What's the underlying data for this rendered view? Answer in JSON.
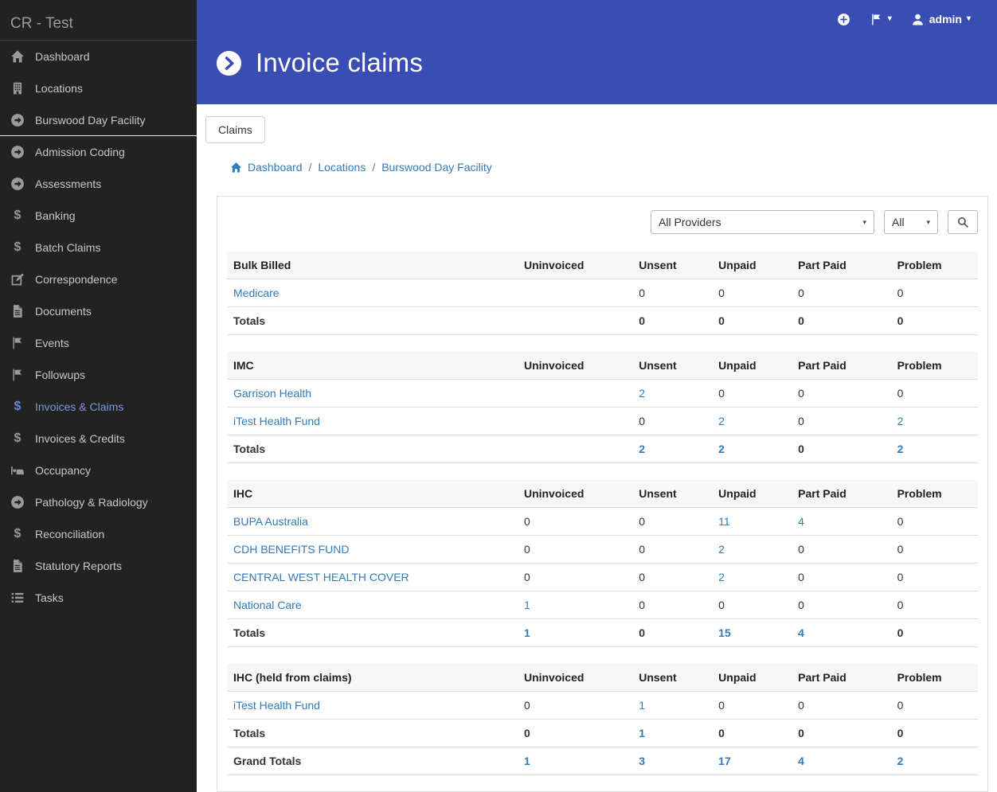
{
  "app": {
    "title": "CR - Test"
  },
  "colors": {
    "banner": "#3a4db3",
    "link": "#337ab7",
    "sidebar_bg": "#222222"
  },
  "sidebar": {
    "items": [
      {
        "label": "Dashboard",
        "icon": "home"
      },
      {
        "label": "Locations",
        "icon": "building"
      },
      {
        "label": "Burswood Day Facility",
        "icon": "arrow-circle",
        "divider_below": true
      },
      {
        "label": "Admission Coding",
        "icon": "arrow-circle"
      },
      {
        "label": "Assessments",
        "icon": "arrow-circle"
      },
      {
        "label": "Banking",
        "icon": "dollar"
      },
      {
        "label": "Batch Claims",
        "icon": "dollar"
      },
      {
        "label": "Correspondence",
        "icon": "pencil"
      },
      {
        "label": "Documents",
        "icon": "file"
      },
      {
        "label": "Events",
        "icon": "flag"
      },
      {
        "label": "Followups",
        "icon": "flag"
      },
      {
        "label": "Invoices & Claims",
        "icon": "dollar",
        "active": true
      },
      {
        "label": "Invoices & Credits",
        "icon": "dollar"
      },
      {
        "label": "Occupancy",
        "icon": "bed"
      },
      {
        "label": "Pathology & Radiology",
        "icon": "arrow-circle"
      },
      {
        "label": "Reconciliation",
        "icon": "dollar"
      },
      {
        "label": "Statutory Reports",
        "icon": "file"
      },
      {
        "label": "Tasks",
        "icon": "list"
      }
    ]
  },
  "header": {
    "title": "Invoice claims",
    "user": "admin"
  },
  "tabs": {
    "claims": "Claims"
  },
  "breadcrumb": [
    "Dashboard",
    "Locations",
    "Burswood Day Facility"
  ],
  "filters": {
    "provider": "All Providers",
    "type": "All"
  },
  "claims": {
    "columns": [
      "Uninvoiced",
      "Unsent",
      "Unpaid",
      "Part Paid",
      "Problem"
    ],
    "totals_label": "Totals",
    "tables": [
      {
        "group": "Bulk Billed",
        "rows": [
          {
            "name": "Medicare",
            "values": [
              "",
              "0",
              "0",
              "0",
              "0"
            ],
            "links": [
              false,
              false,
              false,
              false,
              false
            ]
          }
        ],
        "totals": [
          "",
          "0",
          "0",
          "0",
          "0"
        ],
        "totals_links": [
          false,
          false,
          false,
          false,
          false
        ]
      },
      {
        "group": "IMC",
        "rows": [
          {
            "name": "Garrison Health",
            "values": [
              "",
              "2",
              "0",
              "0",
              "0"
            ],
            "links": [
              false,
              true,
              false,
              false,
              false
            ]
          },
          {
            "name": "iTest Health Fund",
            "values": [
              "",
              "0",
              "2",
              "0",
              "2"
            ],
            "links": [
              false,
              false,
              true,
              false,
              true
            ]
          }
        ],
        "totals": [
          "",
          "2",
          "2",
          "0",
          "2"
        ],
        "totals_links": [
          false,
          true,
          true,
          false,
          true
        ]
      },
      {
        "group": "IHC",
        "rows": [
          {
            "name": "BUPA Australia",
            "values": [
              "0",
              "0",
              "11",
              "4",
              "0"
            ],
            "links": [
              false,
              false,
              true,
              true,
              false
            ]
          },
          {
            "name": "CDH BENEFITS FUND",
            "values": [
              "0",
              "0",
              "2",
              "0",
              "0"
            ],
            "links": [
              false,
              false,
              true,
              false,
              false
            ]
          },
          {
            "name": "CENTRAL WEST HEALTH COVER",
            "values": [
              "0",
              "0",
              "2",
              "0",
              "0"
            ],
            "links": [
              false,
              false,
              true,
              false,
              false
            ]
          },
          {
            "name": "National Care",
            "values": [
              "1",
              "0",
              "0",
              "0",
              "0"
            ],
            "links": [
              true,
              false,
              false,
              false,
              false
            ]
          }
        ],
        "totals": [
          "1",
          "0",
          "15",
          "4",
          "0"
        ],
        "totals_links": [
          true,
          false,
          true,
          true,
          false
        ]
      },
      {
        "group": "IHC (held from claims)",
        "rows": [
          {
            "name": "iTest Health Fund",
            "values": [
              "0",
              "1",
              "0",
              "0",
              "0"
            ],
            "links": [
              false,
              true,
              false,
              false,
              false
            ]
          }
        ],
        "totals": [
          "0",
          "1",
          "0",
          "0",
          "0"
        ],
        "totals_links": [
          false,
          true,
          false,
          false,
          false
        ]
      }
    ],
    "grand_totals": {
      "label": "Grand Totals",
      "values": [
        "1",
        "3",
        "17",
        "4",
        "2"
      ],
      "links": [
        true,
        true,
        true,
        true,
        true
      ]
    }
  }
}
